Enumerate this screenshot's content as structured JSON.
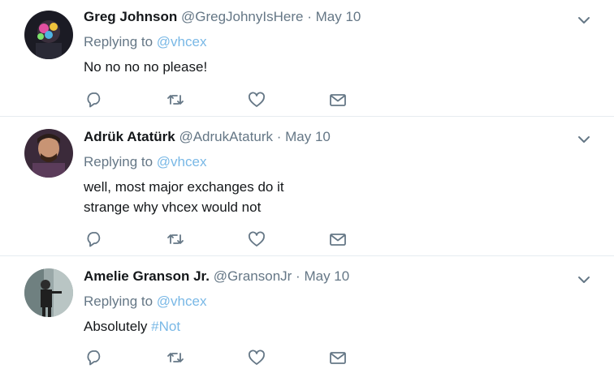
{
  "tweets": [
    {
      "name": "Greg Johnson",
      "handle": "@GregJohnyIsHere",
      "sep": "·",
      "date": "May 10",
      "replying_prefix": "Replying to",
      "replying_to": "@vhcex",
      "body_lines": [
        "No no no no please!"
      ],
      "body_hashtag": ""
    },
    {
      "name": "Adrük Atatürk",
      "handle": "@AdrukAtaturk",
      "sep": "·",
      "date": "May 10",
      "replying_prefix": "Replying to",
      "replying_to": "@vhcex",
      "body_lines": [
        "well, most major exchanges do it",
        "strange why vhcex would not"
      ],
      "body_hashtag": ""
    },
    {
      "name": "Amelie Granson Jr.",
      "handle": "@GransonJr",
      "sep": "·",
      "date": "May 10",
      "replying_prefix": "Replying to",
      "replying_to": "@vhcex",
      "body_lines": [
        "Absolutely"
      ],
      "body_hashtag": "#Not"
    }
  ],
  "icons": {
    "reply": "reply-icon",
    "retweet": "retweet-icon",
    "like": "heart-icon",
    "dm": "envelope-icon",
    "more": "chevron-down-icon"
  },
  "colors": {
    "link": "#79b8e6",
    "secondary_text": "#657786",
    "icon": "#657786",
    "divider": "#e6ecf0"
  }
}
